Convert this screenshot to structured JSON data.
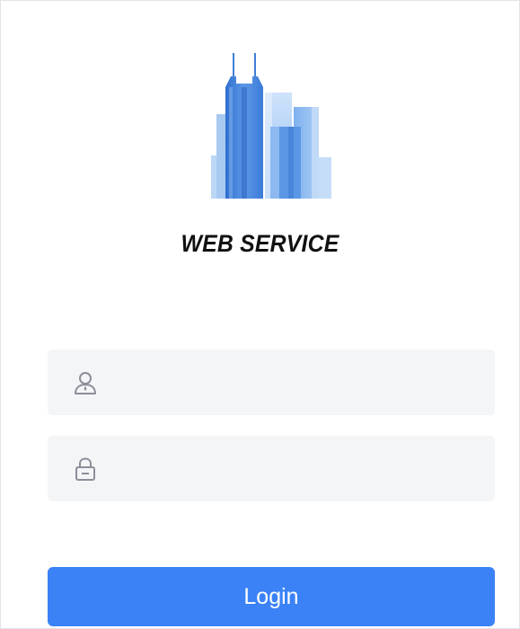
{
  "brand": {
    "title": "WEB SERVICE",
    "logo_icon": "city-buildings-icon"
  },
  "form": {
    "username": {
      "icon": "user-icon",
      "value": "",
      "placeholder": ""
    },
    "password": {
      "icon": "lock-icon",
      "value": "",
      "placeholder": ""
    },
    "login_label": "Login"
  },
  "colors": {
    "primary": "#3b82f6",
    "field_bg": "#f4f5f7",
    "logo_blue": "#4a86d8",
    "logo_light": "#a9cbf3"
  }
}
